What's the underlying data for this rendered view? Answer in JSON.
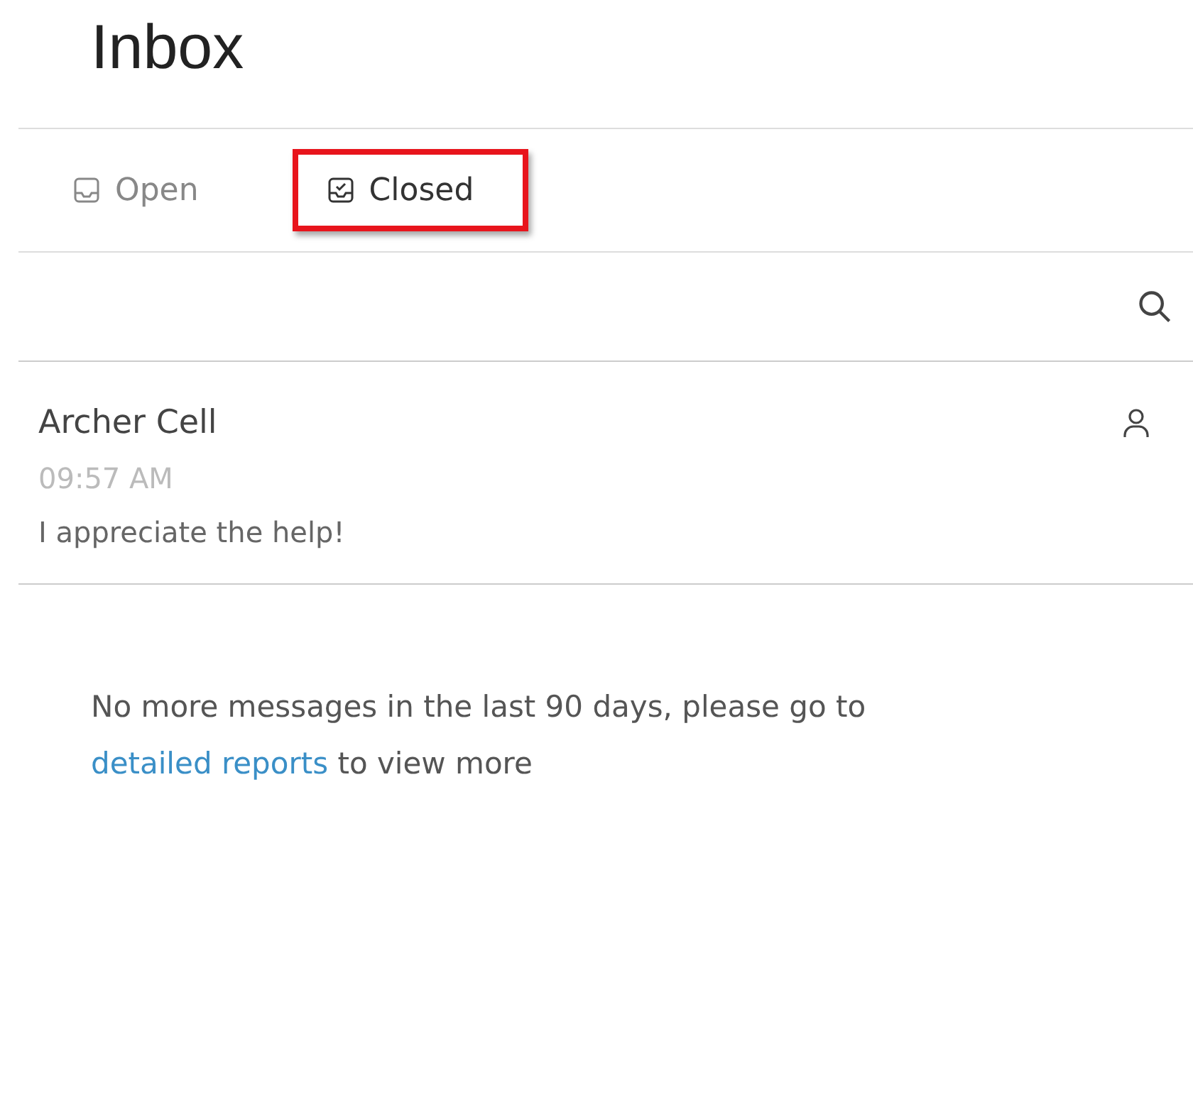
{
  "title": "Inbox",
  "tabs": [
    {
      "label": "Open",
      "kind": "open",
      "selected": false,
      "highlighted": false
    },
    {
      "label": "Closed",
      "kind": "closed",
      "selected": true,
      "highlighted": true
    }
  ],
  "messages": [
    {
      "name": "Archer Cell",
      "time": "09:57 AM",
      "preview": "I appreciate the help!"
    }
  ],
  "notice": {
    "text_before": "No more messages in the last 90 days, please go to",
    "link": "detailed reports",
    "text_after": "to view more"
  }
}
